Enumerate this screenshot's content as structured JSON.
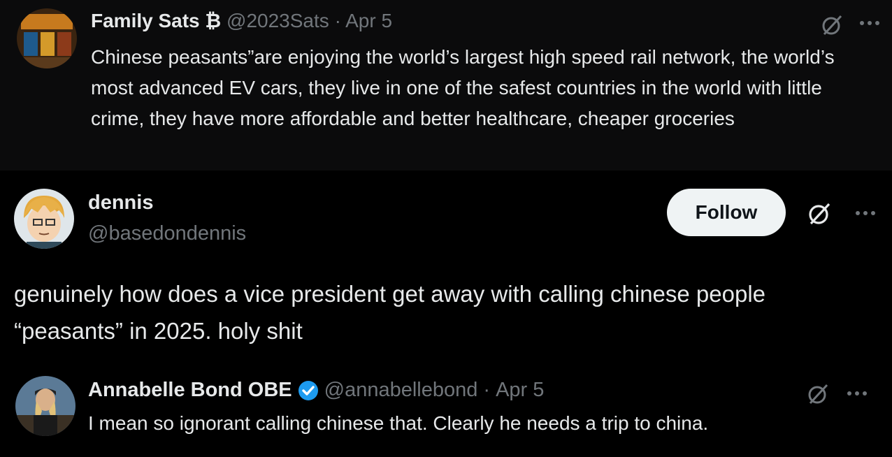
{
  "posts": [
    {
      "name": "Family Sats",
      "name_suffix": "₿",
      "handle": "@2023Sats",
      "sep": "·",
      "date": "Apr 5",
      "text": "Chinese peasants”are enjoying the world’s largest high speed rail network, the world’s most advanced EV cars, they live in one of the safest countries in the world with little crime, they have more affordable and better healthcare, cheaper groceries"
    },
    {
      "name": "dennis",
      "handle": "@basedondennis",
      "follow_label": "Follow",
      "text": "genuinely how does a vice president get away with calling chinese people “peasants” in 2025. holy shit"
    },
    {
      "name": "Annabelle Bond OBE",
      "handle": "@annabellebond",
      "sep": "·",
      "date": "Apr 5",
      "text": "I mean so ignorant calling chinese that. Clearly he needs a trip to china."
    }
  ],
  "icons": {
    "grok": "grok-icon",
    "more": "more-icon",
    "verified": "verified-badge-icon"
  },
  "colors": {
    "background": "#000000",
    "text": "#e7e9ea",
    "muted": "#71767b",
    "verified": "#1d9bf0",
    "follow_bg": "#eff3f4"
  }
}
